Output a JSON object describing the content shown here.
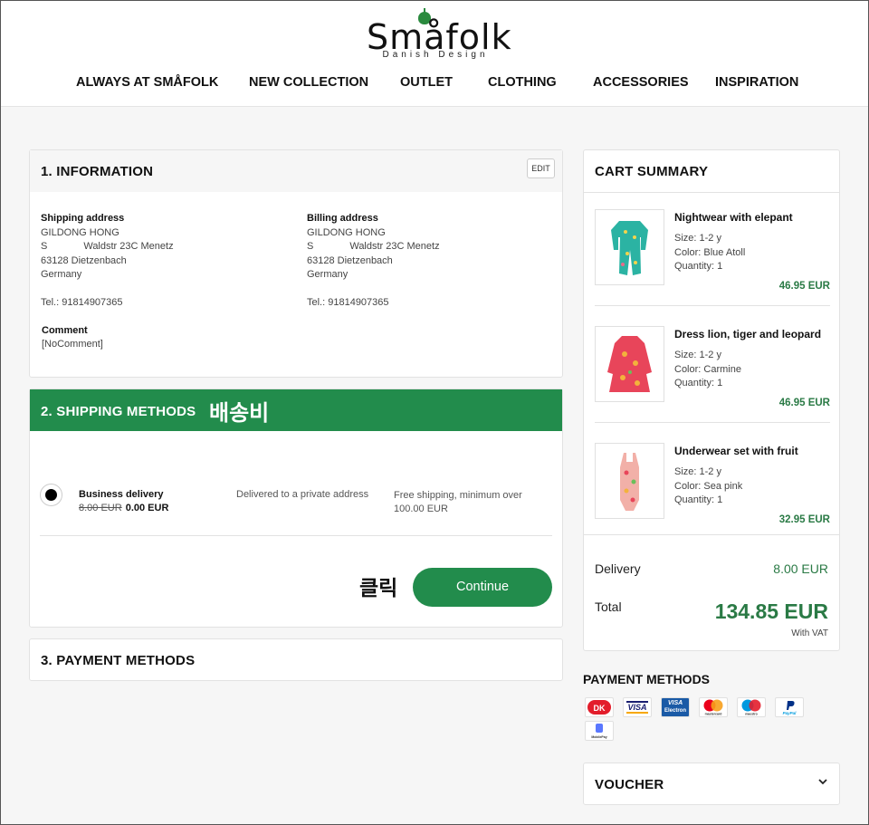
{
  "brand": {
    "name": "Småfolk",
    "tagline": "Danish Design"
  },
  "nav": {
    "items": [
      "ALWAYS AT SMÅFOLK",
      "NEW COLLECTION",
      "OUTLET",
      "CLOTHING",
      "ACCESSORIES",
      "INSPIRATION"
    ]
  },
  "information": {
    "title": "1. INFORMATION",
    "edit_label": "EDIT",
    "shipping": {
      "label": "Shipping address",
      "name": "GILDONG HONG",
      "street_prefix": "S",
      "street": "Waldstr 23C Menetz",
      "city": "63128 Dietzenbach",
      "country": "Germany",
      "phone": "Tel.: 91814907365"
    },
    "billing": {
      "label": "Billing address",
      "name": "GILDONG HONG",
      "street_prefix": "S",
      "street": "Waldstr 23C Menetz",
      "city": "63128 Dietzenbach",
      "country": "Germany",
      "phone": "Tel.: 91814907365"
    },
    "comment_label": "Comment",
    "comment_value": "[NoComment]"
  },
  "shipping_methods": {
    "title": "2. SHIPPING METHODS",
    "annotation": "배송비",
    "option": {
      "name": "Business delivery",
      "old_price": "8.00 EUR",
      "new_price": "0.00 EUR",
      "description": "Delivered to a private address",
      "note": "Free shipping, minimum over 100.00 EUR",
      "selected": true
    },
    "click_annotation": "클릭",
    "continue_label": "Continue"
  },
  "payment_step": {
    "title": "3. PAYMENT METHODS"
  },
  "cart": {
    "title": "CART SUMMARY",
    "items": [
      {
        "name": "Nightwear with elepant",
        "size": "Size: 1-2 y",
        "color": "Color: Blue Atoll",
        "quantity": "Quantity: 1",
        "price": "46.95 EUR",
        "swatch": "#2bb3a3"
      },
      {
        "name": "Dress lion, tiger and leopard",
        "size": "Size: 1-2 y",
        "color": "Color: Carmine",
        "quantity": "Quantity: 1",
        "price": "46.95 EUR",
        "swatch": "#e8455a"
      },
      {
        "name": "Underwear set with fruit",
        "size": "Size: 1-2 y",
        "color": "Color: Sea pink",
        "quantity": "Quantity: 1",
        "price": "32.95 EUR",
        "swatch": "#f2b0a8"
      }
    ],
    "delivery_label": "Delivery",
    "delivery_value": "8.00 EUR",
    "total_label": "Total",
    "total_value": "134.85 EUR",
    "vat_note": "With VAT"
  },
  "payment_methods": {
    "title": "PAYMENT METHODS",
    "icons": [
      {
        "name": "dankort-icon",
        "text": "DK"
      },
      {
        "name": "visa-icon",
        "text": "VISA"
      },
      {
        "name": "visa-electron-icon",
        "text": "VISA"
      },
      {
        "name": "mastercard-icon",
        "text": "mastercard"
      },
      {
        "name": "maestro-icon",
        "text": "maestro"
      },
      {
        "name": "paypal-icon",
        "text": "PayPal"
      },
      {
        "name": "mobilepay-icon",
        "text": "MobilePay"
      }
    ]
  },
  "voucher": {
    "title": "VOUCHER"
  },
  "colors": {
    "accent": "#228c4c",
    "price_green": "#2a7a45"
  }
}
